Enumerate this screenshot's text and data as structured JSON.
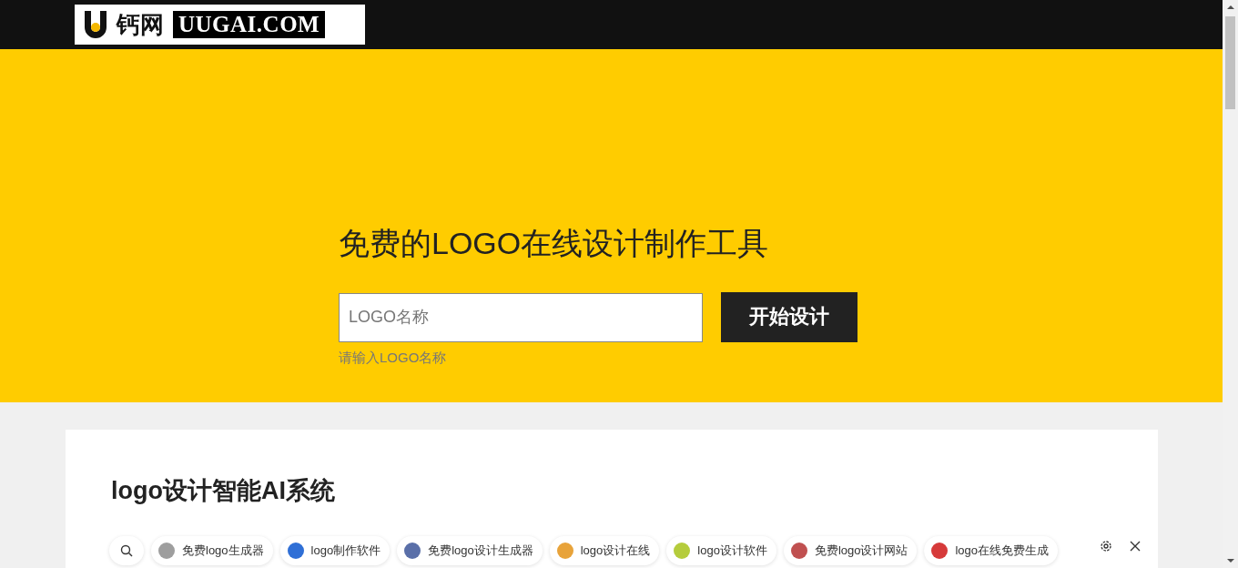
{
  "header": {
    "logo": {
      "cn": "钙网",
      "en": "UUGAI.COM"
    }
  },
  "hero": {
    "title": "免费的LOGO在线设计制作工具",
    "input": {
      "placeholder": "LOGO名称"
    },
    "button": "开始设计",
    "hint": "请输入LOGO名称"
  },
  "section": {
    "heading": "logo设计智能AI系统"
  },
  "suggestions": [
    {
      "label": "免费logo生成器",
      "color": "#9e9e9e"
    },
    {
      "label": "logo制作软件",
      "color": "#2f6fd6"
    },
    {
      "label": "免费logo设计生成器",
      "color": "#5a6fa8"
    },
    {
      "label": "logo设计在线",
      "color": "#e8a33a"
    },
    {
      "label": "logo设计软件",
      "color": "#b5cc3c"
    },
    {
      "label": "免费logo设计网站",
      "color": "#c05050"
    },
    {
      "label": "logo在线免费生成",
      "color": "#d63a3a"
    }
  ]
}
